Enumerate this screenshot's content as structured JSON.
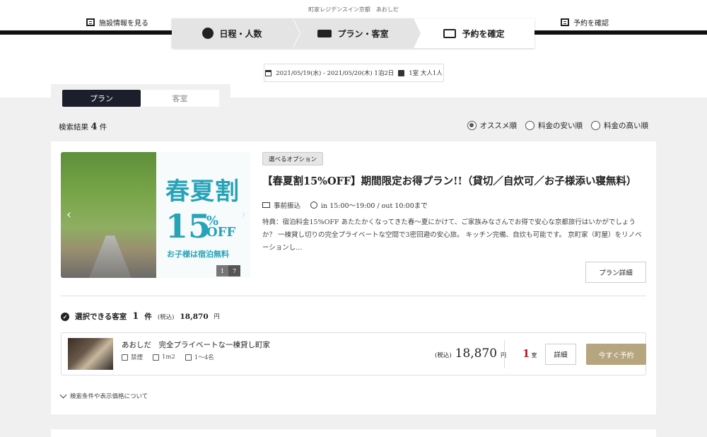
{
  "header": {
    "brand_sub": "町家レジデンスイン京都　あおしだ",
    "left_link": "施設情報を見る",
    "right_link": "予約を確認",
    "steps": [
      {
        "label": "日程・人数"
      },
      {
        "label": "プラン・客室"
      },
      {
        "label": "予約を確定"
      }
    ],
    "search": {
      "dates": "2021/05/19(水) - 2021/05/20(木) 1泊2日",
      "guests": "1室 大人1人"
    }
  },
  "tabs": [
    "プラン",
    "客室"
  ],
  "results": {
    "label": "検索結果",
    "count": "4",
    "unit": "件"
  },
  "sort_options": [
    {
      "label": "オススメ順",
      "selected": true
    },
    {
      "label": "料金の安い順",
      "selected": false
    },
    {
      "label": "料金の高い順",
      "selected": false
    }
  ],
  "plan": {
    "image": {
      "promo_line1": "春夏割",
      "promo_number": "15",
      "promo_pct": "%",
      "promo_off": "OFF",
      "promo_sub": "お子様は宿泊無料",
      "page_current": "1",
      "page_total": "7"
    },
    "badge": "選べるオプション",
    "title": "【春夏割15%OFF】期間限定お得プラン!!（貸切／自炊可／お子様添い寝無料）",
    "payment": "事前振込",
    "checkin": "in 15:00～19:00 / out 10:00まで",
    "description": "特典：宿泊料金15%OFF あたたかくなってきた春～夏にかけて、ご家族みなさんでお得で安心な京都旅行はいかがでしょうか？ 一棟貸し切りの完全プライベートな空間で3密回避の安心旅。 キッチン完備、自炊も可能です。 京町家（町屋）をリノベーションし...",
    "detail_button": "プラン詳細",
    "available": {
      "label": "選択できる客室",
      "count": "1",
      "unit": "件",
      "price_prefix": "(税込)",
      "price": "18,870",
      "yen": "円"
    },
    "room": {
      "name": "あおしだ　完全プライベートな一棟貸し町家",
      "smoking": "禁煙",
      "area": "1m2",
      "capacity": "1～4名",
      "price_prefix": "(税込)",
      "price": "18,870",
      "yen": "円",
      "rooms_num": "1",
      "rooms_unit": "室",
      "detail_button": "詳細",
      "reserve_button": "今すぐ予約"
    },
    "note": "検索条件や表示価格について"
  },
  "colors": {
    "accent_gold": "#b6a67f",
    "tab_active": "#1c1f2b",
    "promo_teal": "#27a3b8",
    "room_count_red": "#b21e2d"
  }
}
